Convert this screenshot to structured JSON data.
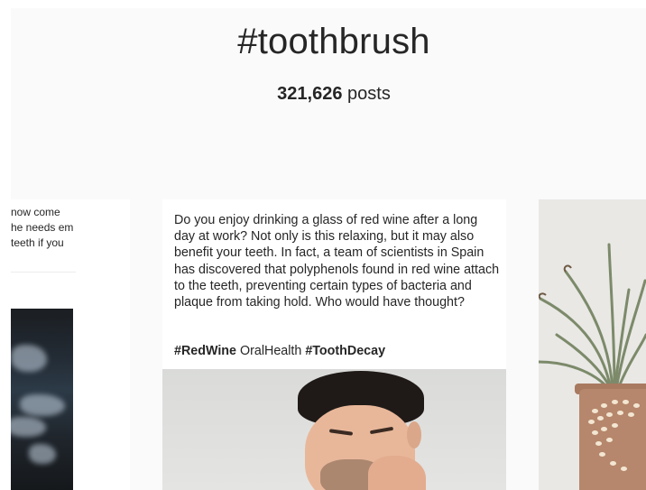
{
  "header": {
    "hashtag": "#toothbrush",
    "post_count": "321,626",
    "post_count_suffix": "posts"
  },
  "posts": {
    "left": {
      "caption_lines": [
        "now come",
        "he needs em",
        "teeth if you"
      ]
    },
    "center": {
      "caption": "Do you enjoy drinking a glass of red wine after a long day at work? Not only is this relaxing, but it may also benefit your teeth. In fact, a team of scientists in Spain has discovered that polyphenols found in red wine attach to the teeth, preventing certain types of bacteria and plaque from taking hold. Who would have thought?",
      "tag1": "#RedWine",
      "tag2": "OralHealth",
      "tag3": "#ToothDecay"
    }
  },
  "colors": {
    "page_background": "#fafafa",
    "text": "#262626"
  }
}
